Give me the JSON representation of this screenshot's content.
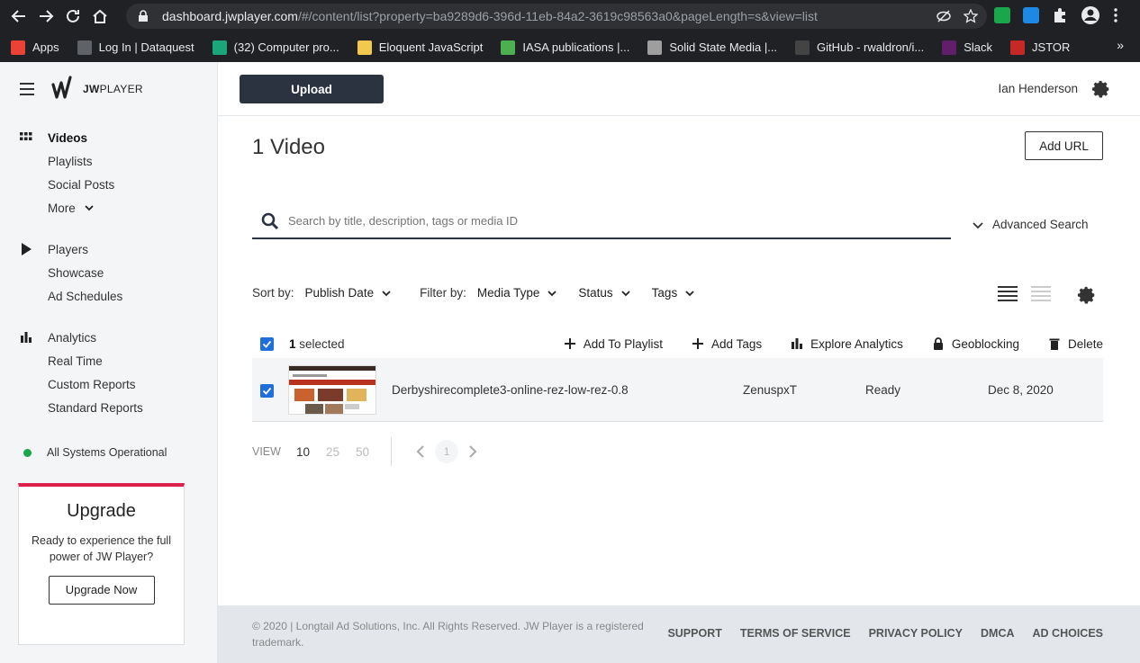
{
  "browser": {
    "url_host": "dashboard.jwplayer.com",
    "url_path": "/#/content/list?property=ba9289d6-396d-11eb-84a2-3619c98563a0&pageLength=s&view=list",
    "bookmarks": [
      {
        "label": "Apps",
        "color": "#ea4335"
      },
      {
        "label": "Log In | Dataquest",
        "color": "#5f6368"
      },
      {
        "label": "(32) Computer pro...",
        "color": "#1aa679"
      },
      {
        "label": "Eloquent JavaScript",
        "color": "#f2c94c"
      },
      {
        "label": "IASA publications |...",
        "color": "#4caf50"
      },
      {
        "label": "Solid State Media |...",
        "color": "#9e9e9e"
      },
      {
        "label": "GitHub - rwaldron/i...",
        "color": "#444"
      },
      {
        "label": "Slack",
        "color": "#611f69"
      },
      {
        "label": "JSTOR",
        "color": "#c62828"
      }
    ]
  },
  "brand": {
    "logo_bold": "JW",
    "logo_light": "PLAYER"
  },
  "sidebar": {
    "groups": [
      {
        "items": [
          {
            "label": "Videos",
            "icon": "grid-icon",
            "active": true
          },
          {
            "label": "Playlists"
          },
          {
            "label": "Social Posts"
          },
          {
            "label": "More",
            "chevron": true
          }
        ]
      },
      {
        "items": [
          {
            "label": "Players",
            "icon": "play-icon"
          },
          {
            "label": "Showcase"
          },
          {
            "label": "Ad Schedules"
          }
        ]
      },
      {
        "items": [
          {
            "label": "Analytics",
            "icon": "bar-chart-icon"
          },
          {
            "label": "Real Time"
          },
          {
            "label": "Custom Reports"
          },
          {
            "label": "Standard Reports"
          }
        ]
      }
    ],
    "status": "All Systems Operational",
    "upgrade": {
      "title": "Upgrade",
      "text": "Ready to experience the full power of JW Player?",
      "button": "Upgrade Now"
    }
  },
  "header": {
    "upload": "Upload",
    "user": "Ian Henderson"
  },
  "content": {
    "count": "1",
    "noun": "Video",
    "add_url": "Add URL",
    "search_placeholder": "Search by title, description, tags or media ID",
    "advanced_search": "Advanced Search",
    "sort_label": "Sort by:",
    "sort_value": "Publish Date",
    "filter_label": "Filter by:",
    "filters": [
      "Media Type",
      "Status",
      "Tags"
    ],
    "selected_count": "1",
    "selected_label": "selected",
    "actions": [
      {
        "label": "Add To Playlist",
        "icon": "plus-icon"
      },
      {
        "label": "Add Tags",
        "icon": "plus-icon"
      },
      {
        "label": "Explore Analytics",
        "icon": "bar-chart-icon"
      },
      {
        "label": "Geoblocking",
        "icon": "lock-icon"
      },
      {
        "label": "Delete",
        "icon": "trash-icon"
      }
    ],
    "rows": [
      {
        "title": "Derbyshirecomplete3-online-rez-low-rez-0.8",
        "author": "ZenuspxT",
        "status": "Ready",
        "date": "Dec 8, 2020"
      }
    ],
    "pager": {
      "view_label": "VIEW",
      "sizes": [
        "10",
        "25",
        "50"
      ],
      "page": "1"
    }
  },
  "footer": {
    "copyright": "© 2020 | Longtail Ad Solutions, Inc. All Rights Reserved. JW Player is a registered trademark.",
    "links": [
      "SUPPORT",
      "TERMS OF SERVICE",
      "PRIVACY POLICY",
      "DMCA",
      "AD CHOICES"
    ]
  },
  "colors": {
    "accent": "#1e6fd9",
    "upload_bg": "#2b3240",
    "upgrade_border": "#dc1f4b",
    "status_ok": "#1aa64a"
  }
}
